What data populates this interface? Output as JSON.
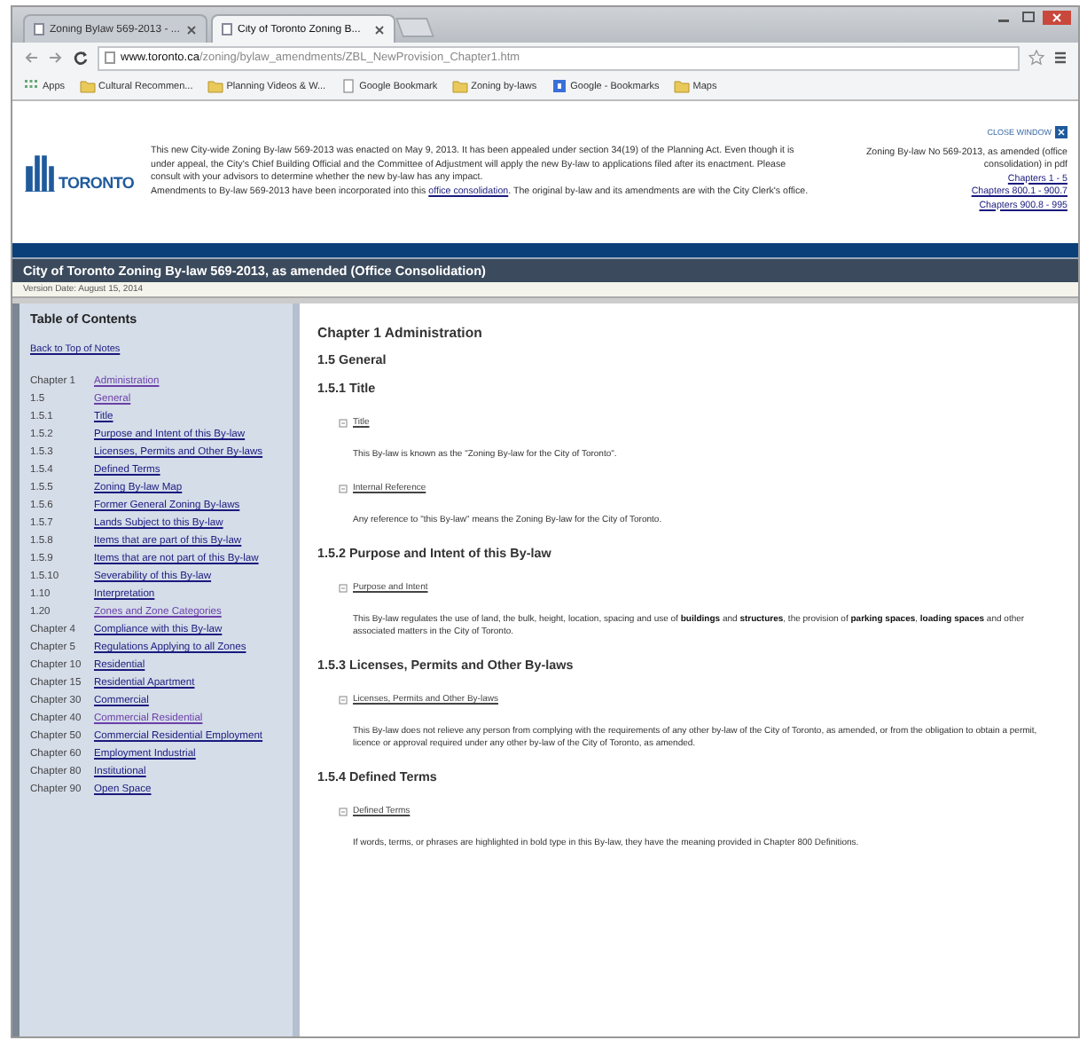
{
  "browser": {
    "tabs": [
      {
        "label": "Zoning Bylaw 569-2013 - ...",
        "selected": false
      },
      {
        "label": "City of Toronto Zoning B...",
        "selected": true
      }
    ],
    "url_host": "www.toronto.ca",
    "url_path": "/zoning/bylaw_amendments/ZBL_NewProvision_Chapter1.htm",
    "bookmarks": [
      {
        "label": "Apps",
        "kind": "apps"
      },
      {
        "label": "Cultural Recommen...",
        "kind": "folder"
      },
      {
        "label": "Planning Videos & W...",
        "kind": "folder"
      },
      {
        "label": "Google Bookmark",
        "kind": "page"
      },
      {
        "label": "Zoning by-laws",
        "kind": "folder"
      },
      {
        "label": "Google - Bookmarks",
        "kind": "google"
      },
      {
        "label": "Maps",
        "kind": "folder"
      }
    ]
  },
  "header": {
    "logo": "TORONTO",
    "notice": [
      "This new City-wide Zoning By-law 569-2013 was enacted on May 9, 2013. It has been appealed under section 34(19) of the Planning Act. Even though it is under appeal, the City's Chief Building Official and the Committee of Adjustment will apply the new By-law to applications filed after its enactment. Please consult with your advisors to determine whether the new by-law has any impact."
    ],
    "amendment": {
      "before": "Amendments to By-law 569-2013 have been incorporated into this",
      "link": "office consolidation",
      "after": ". The original by-law and its amendments are with the City Clerk's office."
    },
    "close": "CLOSE WINDOW",
    "pdf_note": "Zoning By-law No 569-2013, as amended (office consolidation) in pdf",
    "pdf_links": [
      "Chapters 1 - 5",
      "Chapters 800.1 - 900.7",
      "Chapters 900.8 - 995"
    ]
  },
  "title_bar": {
    "title": "City of Toronto Zoning By-law 569-2013, as amended (Office Consolidation)",
    "version": "Version Date: August 15, 2014"
  },
  "toc": {
    "heading": "Table of Contents",
    "back": "Back to Top of Notes",
    "items": [
      {
        "number": "Chapter 1",
        "label": "Administration",
        "visited": true
      },
      {
        "number": "1.5",
        "label": "General",
        "visited": true
      },
      {
        "number": "1.5.1",
        "label": "Title",
        "visited": false
      },
      {
        "number": "1.5.2",
        "label": "Purpose and Intent of this By-law",
        "visited": false
      },
      {
        "number": "1.5.3",
        "label": "Licenses, Permits and Other By-laws",
        "visited": false
      },
      {
        "number": "1.5.4",
        "label": "Defined Terms",
        "visited": false
      },
      {
        "number": "1.5.5",
        "label": "Zoning By-law Map",
        "visited": false
      },
      {
        "number": "1.5.6",
        "label": "Former General Zoning By-laws",
        "visited": false
      },
      {
        "number": "1.5.7",
        "label": "Lands Subject to this By-law",
        "visited": false
      },
      {
        "number": "1.5.8",
        "label": "Items that are part of this By-law",
        "visited": false
      },
      {
        "number": "1.5.9",
        "label": "Items that are not part of this By-law",
        "visited": false
      },
      {
        "number": "1.5.10",
        "label": "Severability of this By-law",
        "visited": false
      },
      {
        "number": "1.10",
        "label": "Interpretation",
        "visited": false
      },
      {
        "number": "1.20",
        "label": "Zones and Zone Categories",
        "visited": true
      },
      {
        "number": "Chapter 4",
        "label": "Compliance with this By-law",
        "visited": false
      },
      {
        "number": "Chapter 5",
        "label": "Regulations Applying to all Zones",
        "visited": false
      },
      {
        "number": "Chapter 10",
        "label": "Residential",
        "visited": false
      },
      {
        "number": "Chapter 15",
        "label": "Residential Apartment",
        "visited": false
      },
      {
        "number": "Chapter 30",
        "label": "Commercial",
        "visited": false
      },
      {
        "number": "Chapter 40",
        "label": "Commercial Residential",
        "visited": true
      },
      {
        "number": "Chapter 50",
        "label": "Commercial Residential Employment",
        "visited": false
      },
      {
        "number": "Chapter 60",
        "label": "Employment Industrial",
        "visited": false
      },
      {
        "number": "Chapter 80",
        "label": "Institutional",
        "visited": false
      },
      {
        "number": "Chapter 90",
        "label": "Open Space",
        "visited": false
      }
    ]
  },
  "content": {
    "chapter": "Chapter 1 Administration",
    "section": "1.5 General",
    "subsections": [
      {
        "heading": "1.5.1 Title",
        "provisions": [
          {
            "label": "Title",
            "text": "This By-law is known as the \"Zoning By-law for the City of Toronto\"."
          },
          {
            "label": "Internal Reference",
            "text": "Any reference to \"this By-law\" means the Zoning By-law for the City of Toronto."
          }
        ]
      },
      {
        "heading": "1.5.2 Purpose and Intent of this By-law",
        "provisions": [
          {
            "label": "Purpose and Intent",
            "text": "This By-law regulates the use of land, the bulk, height, location, spacing and use of **buildings** and **structures**, the provision of **parking spaces**, **loading spaces** and other associated matters in the City of Toronto."
          }
        ]
      },
      {
        "heading": "1.5.3 Licenses, Permits and Other By-laws",
        "provisions": [
          {
            "label": "Licenses, Permits and Other By-laws",
            "text": "This By-law does not relieve any person from complying with the requirements of any other by-law of the City of Toronto, as amended, or from the obligation to obtain a permit, licence or approval required under any other by-law of the City of Toronto, as amended."
          }
        ]
      },
      {
        "heading": "1.5.4 Defined Terms",
        "provisions": [
          {
            "label": "Defined Terms",
            "text": "If words, terms, or phrases are highlighted in bold type in this By-law, they have the meaning provided in Chapter 800 Definitions."
          }
        ]
      }
    ]
  }
}
